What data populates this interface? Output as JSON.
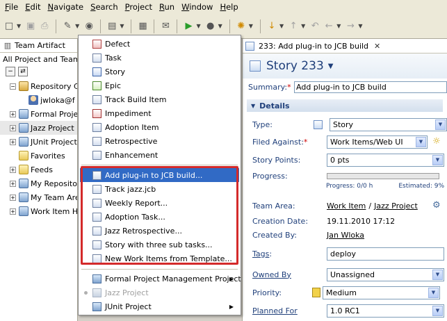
{
  "menubar": {
    "items": [
      "File",
      "Edit",
      "Navigate",
      "Search",
      "Project",
      "Run",
      "Window",
      "Help"
    ]
  },
  "left_view": {
    "tab_title": "Team Artifact",
    "subtitle": "All Project and Team A",
    "tree": [
      {
        "label": "Repository C",
        "icon": "repository-icon",
        "expanded": true
      },
      {
        "label": "jwloka@f",
        "icon": "user-icon",
        "indent": 1
      },
      {
        "label": "Formal Project",
        "icon": "project-area-icon"
      },
      {
        "label": "Jazz Project [",
        "icon": "project-area-icon"
      },
      {
        "label": "JUnit Project",
        "icon": "project-area-icon"
      },
      {
        "label": "Favorites",
        "icon": "favorites-icon",
        "leaf": true
      },
      {
        "label": "Feeds",
        "icon": "feeds-icon"
      },
      {
        "label": "My Repositor",
        "icon": "folder-icon"
      },
      {
        "label": "My Team Are",
        "icon": "team-icon"
      },
      {
        "label": "Work Item Hi",
        "icon": "history-icon"
      }
    ]
  },
  "dropdown": {
    "section1": [
      {
        "label": "Defect",
        "icon": "defect-icon"
      },
      {
        "label": "Task",
        "icon": "task-icon"
      },
      {
        "label": "Story",
        "icon": "story-icon"
      },
      {
        "label": "Epic",
        "icon": "epic-icon"
      },
      {
        "label": "Track Build Item",
        "icon": "build-icon"
      },
      {
        "label": "Impediment",
        "icon": "impediment-icon"
      },
      {
        "label": "Adoption Item",
        "icon": "adoption-icon"
      },
      {
        "label": "Retrospective",
        "icon": "retrospective-icon"
      },
      {
        "label": "Enhancement",
        "icon": "enhancement-icon"
      }
    ],
    "section2": [
      {
        "label": "Add plug-in to JCB build...",
        "icon": "template-icon",
        "selected": true
      },
      {
        "label": "Track jazz.jcb",
        "icon": "template-icon"
      },
      {
        "label": "Weekly Report...",
        "icon": "template-icon"
      },
      {
        "label": "Adoption Task...",
        "icon": "template-icon"
      },
      {
        "label": "Jazz Retrospective...",
        "icon": "template-icon"
      },
      {
        "label": "Story with three sub tasks...",
        "icon": "template-icon"
      },
      {
        "label": "New Work Items from Template...",
        "icon": "template-icon"
      }
    ],
    "section3": [
      {
        "label": "Formal Project Management Project",
        "icon": "project-area-icon",
        "submenu": true
      },
      {
        "label": "Jazz Project",
        "icon": "project-area-icon",
        "disabled": true
      },
      {
        "label": "JUnit Project",
        "icon": "project-area-icon",
        "submenu": true
      }
    ]
  },
  "editor": {
    "tab_title": "233: Add plug-in to JCB build",
    "heading": "Story 233",
    "summary_label": "Summary:",
    "summary_required": "*",
    "summary_value": "Add plug-in to JCB build",
    "details_label": "Details",
    "fields": {
      "type_label": "Type:",
      "type_value": "Story",
      "filed_label": "Filed Against:",
      "filed_required": "*",
      "filed_value": "Work Items/Web UI",
      "points_label": "Story Points:",
      "points_value": "0 pts",
      "progress_label": "Progress:",
      "progress_text": "Progress: 0/0 h",
      "estimated_text": "Estimated: 9%",
      "progress_fraction": 0,
      "team_label": "Team Area:",
      "team_link1": "Work Item",
      "team_sep": "/",
      "team_link2": "Jazz Project",
      "creation_label": "Creation Date:",
      "creation_value": "19.11.2010 17:12",
      "createdby_label": "Created By:",
      "createdby_value": "Jan Wloka",
      "tags_label": "Tags",
      "tags_colon": ":",
      "tags_value": "deploy",
      "owned_label": "Owned By",
      "owned_value": "Unassigned",
      "priority_label": "Priority:",
      "priority_value": "Medium",
      "planned_label": "Planned For",
      "planned_value": "1.0 RC1"
    }
  },
  "colors": {
    "selection": "#316ac5",
    "highlight_border": "#d42a2a",
    "heading": "#1f3f7a"
  }
}
